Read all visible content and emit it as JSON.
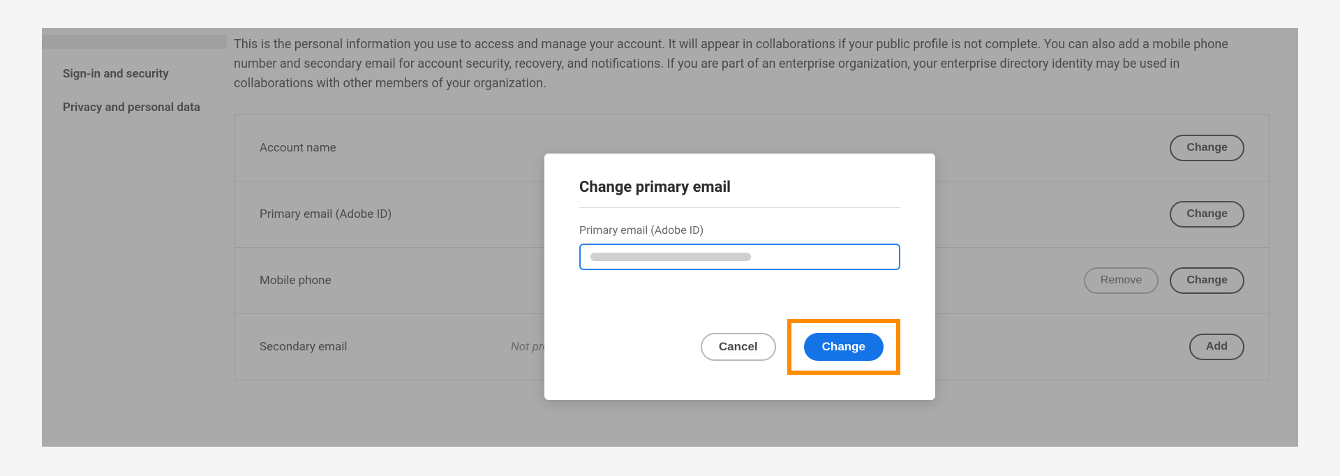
{
  "sidebar": {
    "items": [
      {
        "label": "Sign-in and security"
      },
      {
        "label": "Privacy and personal data"
      }
    ]
  },
  "main": {
    "description": "This is the personal information you use to access and manage your account. It will appear in collaborations if your public profile is not complete. You can also add a mobile phone number and secondary email for account security, recovery, and notifications. If you are part of an enterprise organization, your enterprise directory identity may be used in collaborations with other members of your organization.",
    "rows": [
      {
        "label": "Account name",
        "value": "",
        "actions": [
          {
            "label": "Change",
            "style": "dark"
          }
        ]
      },
      {
        "label": "Primary email (Adobe ID)",
        "value": "",
        "actions": [
          {
            "label": "Change",
            "style": "dark"
          }
        ]
      },
      {
        "label": "Mobile phone",
        "value": "",
        "actions": [
          {
            "label": "Remove",
            "style": "light"
          },
          {
            "label": "Change",
            "style": "dark"
          }
        ]
      },
      {
        "label": "Secondary email",
        "value": "Not provided",
        "actions": [
          {
            "label": "Add",
            "style": "dark"
          }
        ]
      }
    ]
  },
  "modal": {
    "title": "Change primary email",
    "field_label": "Primary email (Adobe ID)",
    "input_value": "",
    "cancel_label": "Cancel",
    "change_label": "Change"
  }
}
